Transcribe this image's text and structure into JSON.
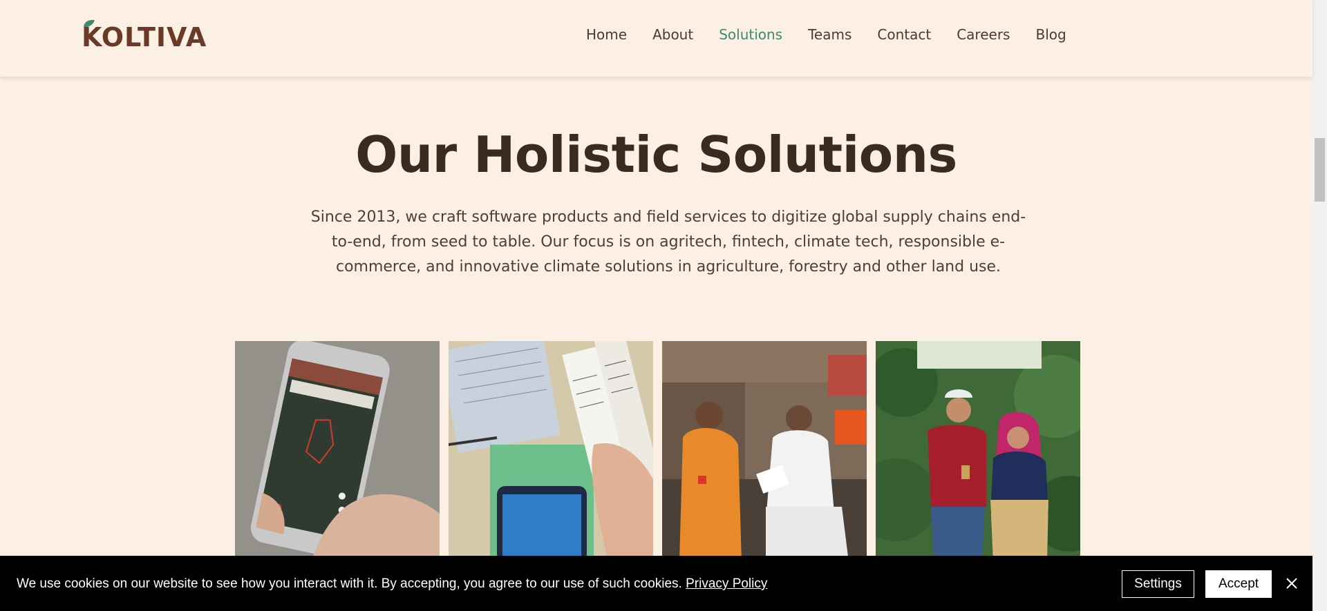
{
  "brand": {
    "name": "KOLTIVA"
  },
  "nav": {
    "items": [
      {
        "label": "Home"
      },
      {
        "label": "About"
      },
      {
        "label": "Solutions"
      },
      {
        "label": "Teams"
      },
      {
        "label": "Contact"
      },
      {
        "label": "Careers"
      },
      {
        "label": "Blog"
      }
    ],
    "active": "Solutions",
    "active_color": "#3e8b6e"
  },
  "main": {
    "title": "Our Holistic Solutions",
    "description": "Since 2013, we craft software products and field services to digitize global supply chains end-to-end, from seed to table. Our focus is on agritech, fintech, climate tech, responsible e-commerce, and innovative climate solutions in agriculture, forestry and other land use."
  },
  "cookie_banner": {
    "text": "We use cookies on our website to see how you interact with it. By accepting, you agree to our use of such cookies.",
    "link_label": "Privacy Policy",
    "settings_label": "Settings",
    "accept_label": "Accept",
    "close_icon": "close-icon"
  },
  "colors": {
    "background": "#fcefe3",
    "heading": "#3b2a20",
    "brand": "#6b3a26",
    "leaf": "#3e8b6e"
  }
}
